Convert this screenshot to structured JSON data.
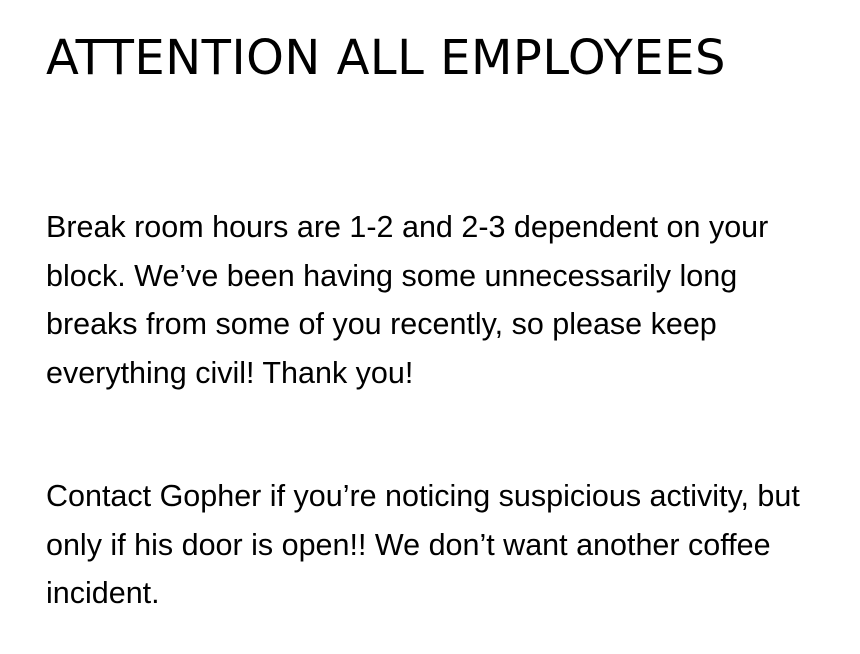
{
  "notice": {
    "title": "ATTENTION ALL EMPLOYEES",
    "paragraphs": [
      "Break room hours are 1-2 and 2-3 dependent on your block. We’ve been having some unnecessarily long breaks from some of you recently, so please keep everything civil! Thank you!",
      "Contact Gopher if you’re noticing suspicious activity, but only if his door is open!! We don’t want another coffee incident."
    ]
  }
}
